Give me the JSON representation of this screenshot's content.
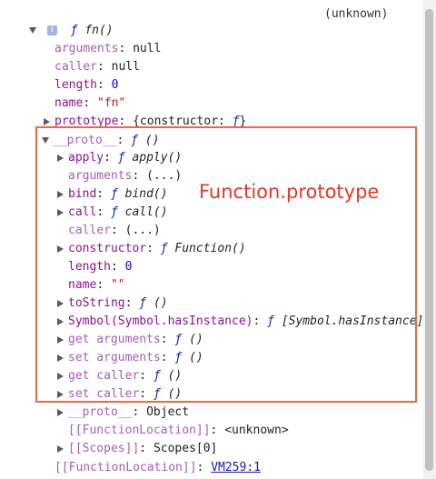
{
  "header": {
    "source": "(unknown)"
  },
  "fn": {
    "keyword": "ƒ",
    "name": "fn()",
    "arguments_key": "arguments",
    "arguments_value": "null",
    "caller_key": "caller",
    "caller_value": "null",
    "length_key": "length",
    "length_value": "0",
    "name_key": "name",
    "name_value": "\"fn\"",
    "prototype_key": "prototype",
    "prototype_value_prefix": "{constructor: ",
    "prototype_value_fn": "ƒ",
    "prototype_value_suffix": "}"
  },
  "proto": {
    "key": "__proto__",
    "keyword": "ƒ",
    "value": "()",
    "items": {
      "apply": {
        "key": "apply",
        "keyword": "ƒ",
        "value": "apply()"
      },
      "arguments": {
        "key": "arguments",
        "value": "(...)"
      },
      "bind": {
        "key": "bind",
        "keyword": "ƒ",
        "value": "bind()"
      },
      "call": {
        "key": "call",
        "keyword": "ƒ",
        "value": "call()"
      },
      "caller": {
        "key": "caller",
        "value": "(...)"
      },
      "constructor": {
        "key": "constructor",
        "keyword": "ƒ",
        "value": "Function()"
      },
      "length": {
        "key": "length",
        "value": "0"
      },
      "name": {
        "key": "name",
        "value": "\"\""
      },
      "toString": {
        "key": "toString",
        "keyword": "ƒ",
        "value": "()"
      },
      "hasInstance": {
        "key": "Symbol(Symbol.hasInstance)",
        "keyword": "ƒ",
        "value": "[Symbol.hasInstance]"
      },
      "get_arguments": {
        "key": "get arguments",
        "keyword": "ƒ",
        "value": "()"
      },
      "set_arguments": {
        "key": "set arguments",
        "keyword": "ƒ",
        "value": "()"
      },
      "get_caller": {
        "key": "get caller",
        "keyword": "ƒ",
        "value": "()"
      },
      "set_caller": {
        "key": "set caller",
        "keyword": "ƒ",
        "value": "()"
      },
      "inner_proto": {
        "key": "__proto__",
        "value": "Object"
      },
      "function_location": {
        "key": "[[FunctionLocation]]",
        "value": "<unknown>"
      },
      "scopes": {
        "key": "[[Scopes]]",
        "value": "Scopes[0]"
      }
    }
  },
  "fn_location": {
    "key": "[[FunctionLocation]]",
    "value": "VM259:1"
  },
  "annotation": {
    "label": "Function.prototype",
    "color": "#e8362a",
    "box_color": "#ec6a3f"
  }
}
